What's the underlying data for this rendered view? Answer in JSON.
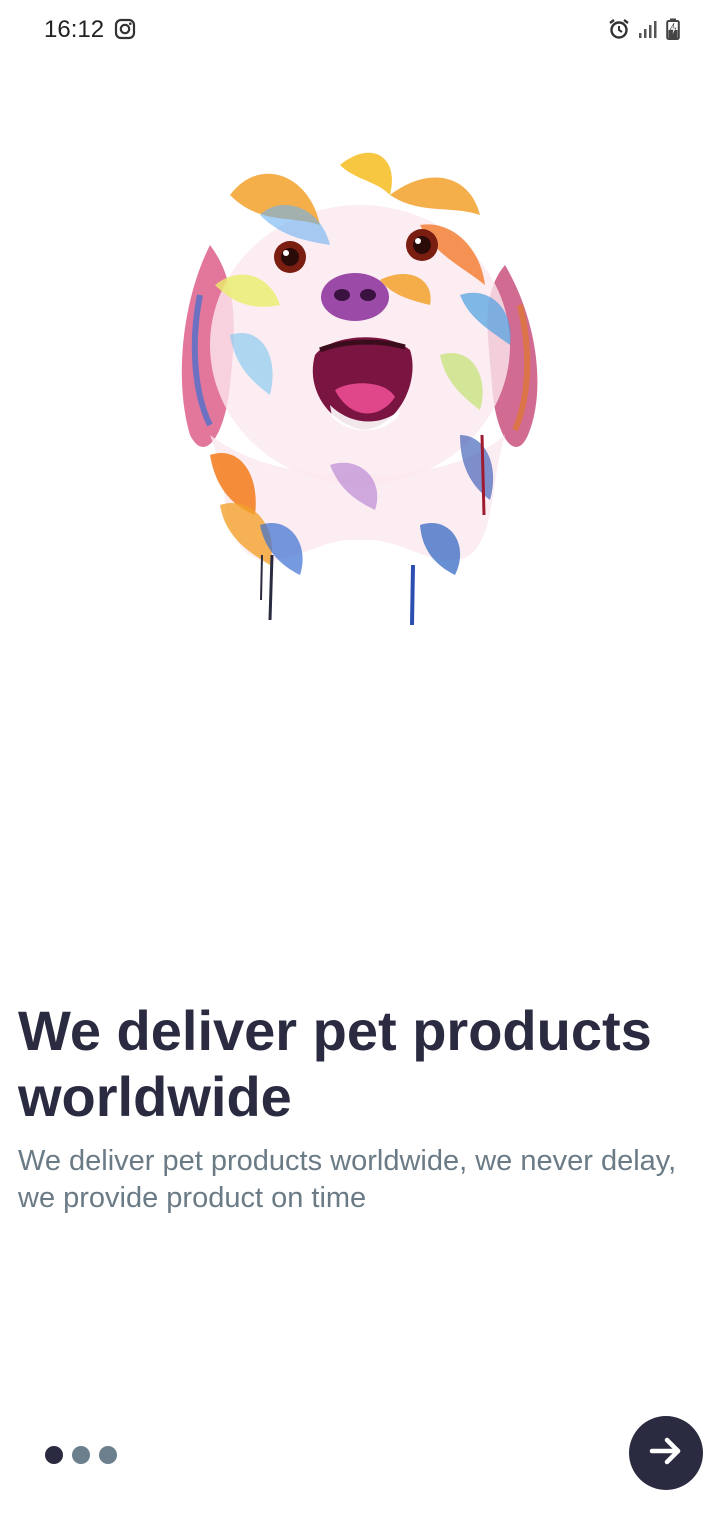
{
  "status_bar": {
    "time": "16:12",
    "icons": [
      "instagram-icon",
      "alarm-icon",
      "signal-icon",
      "battery-charging-icon"
    ]
  },
  "onboarding": {
    "illustration": "watercolor-dog-illustration",
    "title": "We deliver pet products worldwide",
    "description": "We deliver pet products worldwide, we never delay, we provide product on time",
    "pager": {
      "total": 3,
      "active_index": 0
    },
    "next_button_icon": "arrow-right-icon"
  },
  "colors": {
    "background": "#ffffff",
    "primary_dark": "#2a2a40",
    "secondary_text": "#6b7b86",
    "inactive_dot": "#6b7f8c"
  }
}
